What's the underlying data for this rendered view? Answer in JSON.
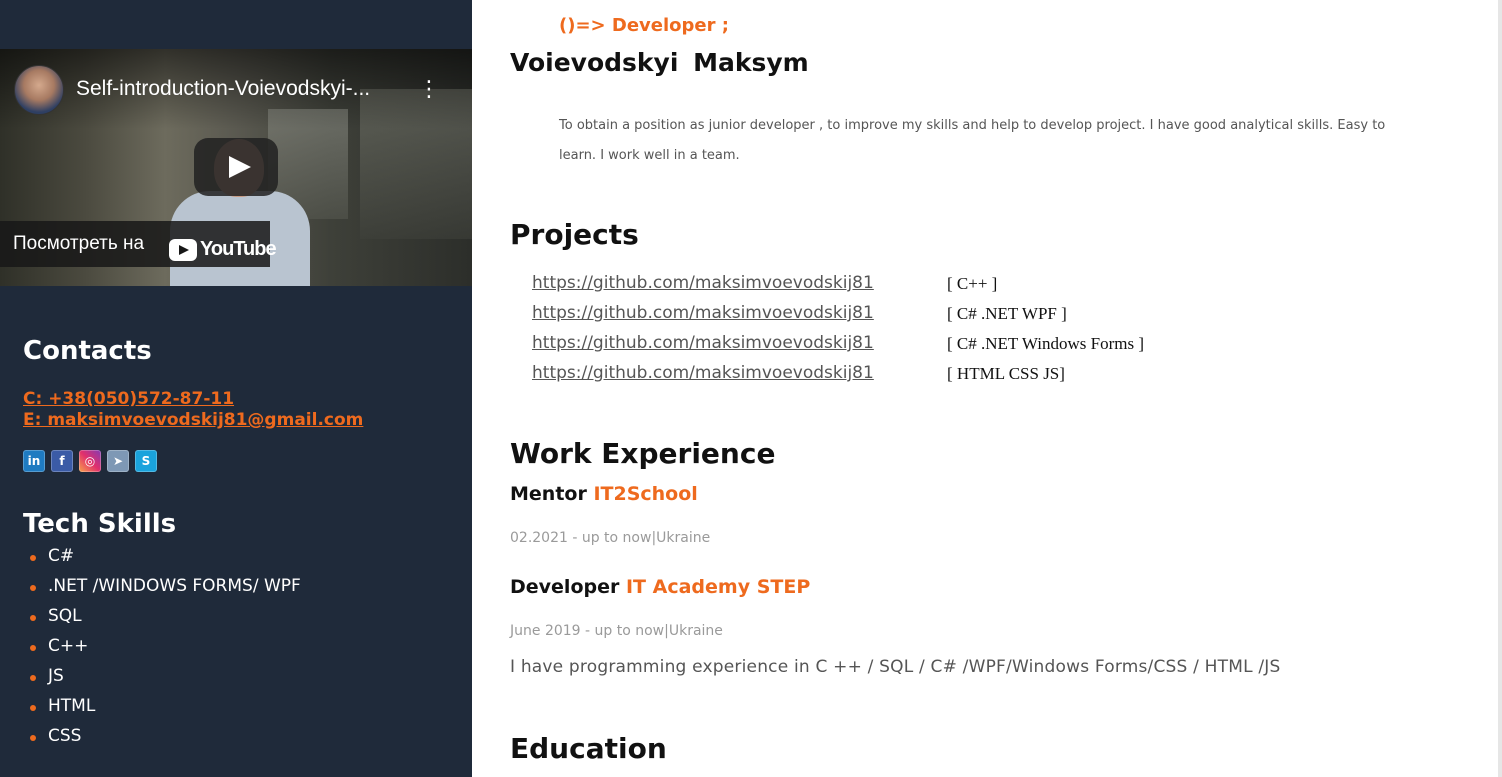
{
  "video": {
    "title": "Self-introduction-Voievodskyi-...",
    "watch_label": "Посмотреть на",
    "platform": "YouTube"
  },
  "contacts": {
    "heading": "Contacts",
    "phone": "C: +38(050)572-87-11",
    "email": "E: maksimvoevodskij81@gmail.com",
    "socials": [
      {
        "name": "linkedin-icon",
        "glyph": "in"
      },
      {
        "name": "facebook-icon",
        "glyph": "f"
      },
      {
        "name": "instagram-icon",
        "glyph": "◎"
      },
      {
        "name": "telegram-icon",
        "glyph": "➤"
      },
      {
        "name": "skype-icon",
        "glyph": "S"
      }
    ]
  },
  "skills": {
    "heading": "Tech Skills",
    "items": [
      "C#",
      ".NET /WINDOWS FORMS/ WPF",
      "SQL",
      "C++",
      "JS",
      "HTML",
      "CSS"
    ]
  },
  "profile": {
    "tagline": "()=> Developer ;",
    "name": "Voievodskyi  Maksym",
    "objective": "To obtain a position as junior developer , to improve my skills and help to develop project. I have good analytical skills. Easy to learn. I work well in a team."
  },
  "projects": {
    "heading": "Projects",
    "items": [
      {
        "url": "https://github.com/maksimvoevodskij81",
        "tech": "[ C++ ]"
      },
      {
        "url": "https://github.com/maksimvoevodskij81",
        "tech": "[ C# .NET WPF ]"
      },
      {
        "url": "https://github.com/maksimvoevodskij81",
        "tech": "[ C# .NET Windows Forms ]"
      },
      {
        "url": "https://github.com/maksimvoevodskij81",
        "tech": "[ HTML CSS JS]"
      }
    ]
  },
  "work": {
    "heading": "Work Experience",
    "jobs": [
      {
        "role": "Mentor",
        "org": "IT2School",
        "meta": "02.2021 - up to now|Ukraine"
      },
      {
        "role": "Developer",
        "org": "IT Academy STEP",
        "meta": "June 2019 - up to now|Ukraine",
        "desc": "I have programming experience in C ++ / SQL / C# /WPF/Windows Forms/CSS / HTML /JS"
      }
    ]
  },
  "education": {
    "heading": "Education"
  },
  "colors": {
    "sidebar_bg": "#1f2a3a",
    "accent": "#ee6a1e"
  }
}
